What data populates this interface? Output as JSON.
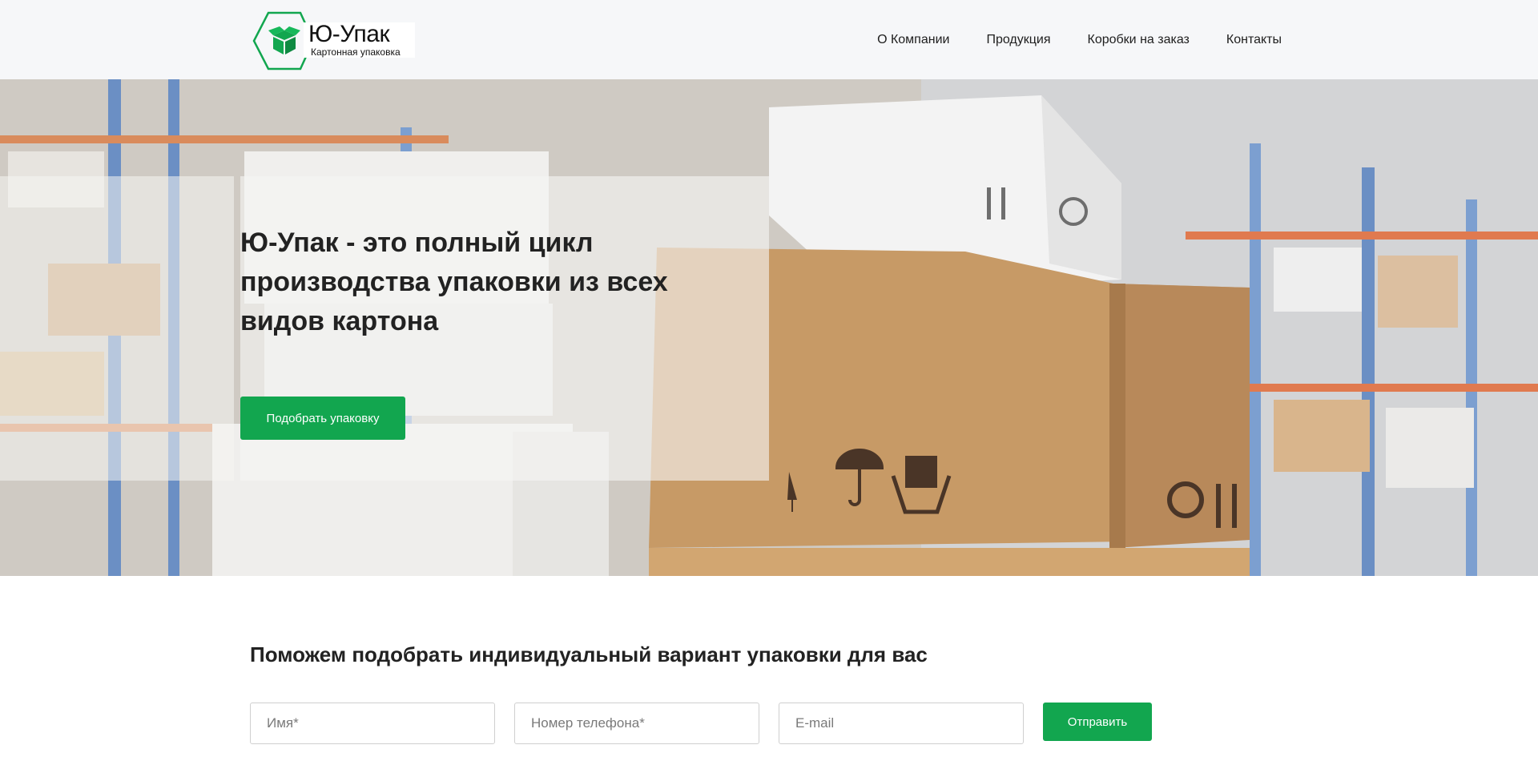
{
  "header": {
    "logo": {
      "title": "Ю-Упак",
      "subtitle": "Картонная упаковка",
      "brand_color": "#12a64f"
    },
    "nav": [
      "О Компании",
      "Продукция",
      "Коробки на заказ",
      "Контакты"
    ]
  },
  "hero": {
    "title": "Ю-Упак - это полный цикл производства упаковки из всех видов картона",
    "button_label": "Подобрать упаковку",
    "background_icons": [
      "fragile-icon",
      "keep-dry-icon",
      "handle-with-care-icon",
      "recycle-icon",
      "this-way-up-icon"
    ]
  },
  "form_section": {
    "title": "Поможем подобрать индивидуальный вариант упаковки для вас",
    "fields": [
      {
        "placeholder": "Имя*",
        "value": ""
      },
      {
        "placeholder": "Номер телефона*",
        "value": ""
      },
      {
        "placeholder": "E-mail",
        "value": ""
      }
    ],
    "submit_label": "Отправить"
  },
  "colors": {
    "accent": "#12a64f",
    "header_bg": "#f6f7f9",
    "text": "#222222"
  }
}
